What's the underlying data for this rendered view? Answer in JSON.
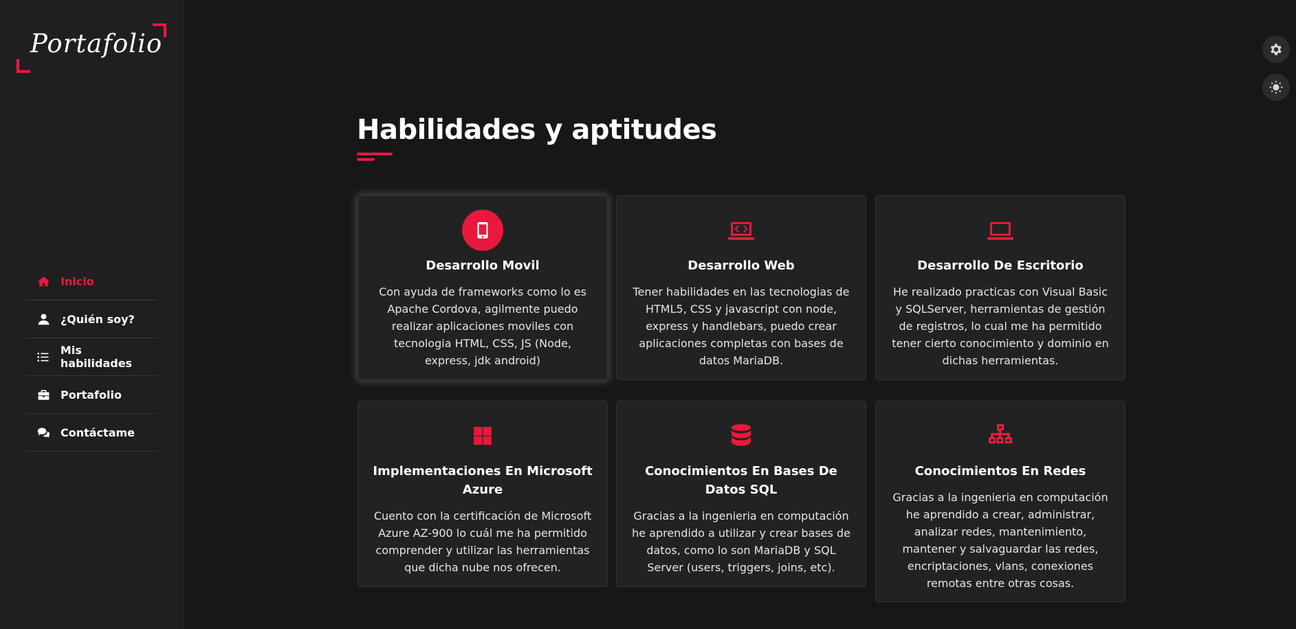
{
  "brand": {
    "logo_text": "Portafolio",
    "accent": "#e8193c"
  },
  "nav": {
    "items": [
      {
        "label": "Inicio",
        "icon": "home-icon",
        "active": true
      },
      {
        "label": "¿Quién soy?",
        "icon": "user-icon",
        "active": false
      },
      {
        "label": "Mis habilidades",
        "icon": "list-icon",
        "active": false
      },
      {
        "label": "Portafolio",
        "icon": "briefcase-icon",
        "active": false
      },
      {
        "label": "Contáctame",
        "icon": "comments-icon",
        "active": false
      }
    ]
  },
  "settings": {
    "icons": [
      "gear-icon",
      "sun-icon"
    ]
  },
  "section": {
    "title": "Habilidades y aptitudes"
  },
  "cards": [
    {
      "icon": "mobile-icon",
      "title": "Desarrollo Movil",
      "desc": "Con ayuda de frameworks como lo es Apache Cordova, agilmente puedo realizar aplicaciones moviles con tecnologia HTML, CSS, JS (Node, express, jdk android)"
    },
    {
      "icon": "laptop-code-icon",
      "title": "Desarrollo Web",
      "desc": "Tener habilidades en las tecnologias de HTML5, CSS y javascript con node, express y handlebars, puedo crear aplicaciones completas con bases de datos MariaDB."
    },
    {
      "icon": "laptop-icon",
      "title": "Desarrollo De Escritorio",
      "desc": "He realizado practicas con Visual Basic y SQLServer, herramientas de gestión de registros, lo cual me ha permitido tener cierto conocimiento y dominio en dichas herramientas."
    },
    {
      "icon": "windows-icon",
      "title": "Implementaciones En Microsoft Azure",
      "desc": "Cuento con la certificación de Microsoft Azure AZ-900 lo cuál me ha permitido comprender y utilizar las herramientas que dicha nube nos ofrecen."
    },
    {
      "icon": "database-icon",
      "title": "Conocimientos En Bases De Datos SQL",
      "desc": "Gracias a la ingenieria en computación he aprendido a utilizar y crear bases de datos, como lo son MariaDB y SQL Server (users, triggers, joins, etc)."
    },
    {
      "icon": "network-icon",
      "title": "Conocimientos En Redes",
      "desc": "Gracias a la ingenieria en computación he aprendido a crear, administrar, analizar redes, mantenimiento, mantener y salvaguardar las redes, encriptaciones, vlans, conexiones remotas entre otras cosas."
    }
  ]
}
